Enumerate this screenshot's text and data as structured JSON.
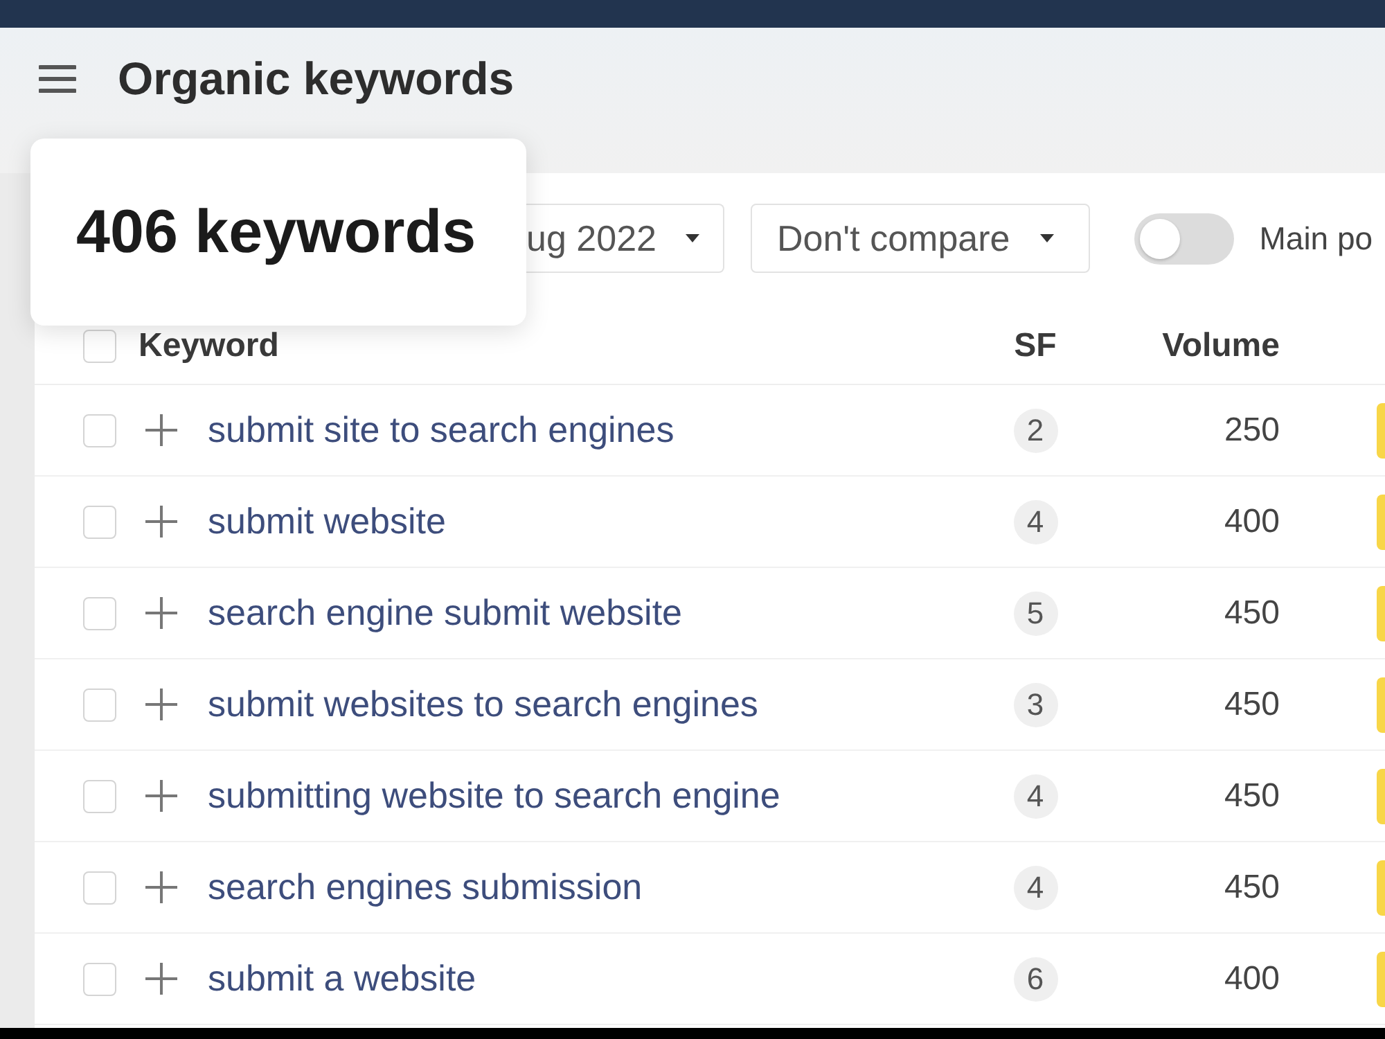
{
  "header": {
    "title": "Organic keywords"
  },
  "popover": {
    "text": "406 keywords"
  },
  "toolbar": {
    "date_select": {
      "value": "ug 2022"
    },
    "compare_select": {
      "value": "Don't compare"
    },
    "toggle": {
      "label": "Main po",
      "on": false
    }
  },
  "table": {
    "select_all": {
      "checked": false
    },
    "columns": [
      "Keyword",
      "SF",
      "Volume"
    ],
    "rows": [
      {
        "checked": false,
        "keyword": "submit site to search engines",
        "sf": "2",
        "volume": "250",
        "color": "#f8d648"
      },
      {
        "checked": false,
        "keyword": "submit website",
        "sf": "4",
        "volume": "400",
        "color": "#f8d648"
      },
      {
        "checked": false,
        "keyword": "search engine submit website",
        "sf": "5",
        "volume": "450",
        "color": "#f8d648"
      },
      {
        "checked": false,
        "keyword": "submit websites to search engines",
        "sf": "3",
        "volume": "450",
        "color": "#f8d648"
      },
      {
        "checked": false,
        "keyword": "submitting website to search engine",
        "sf": "4",
        "volume": "450",
        "color": "#f8d648"
      },
      {
        "checked": false,
        "keyword": "search engines submission",
        "sf": "4",
        "volume": "450",
        "color": "#f8d648"
      },
      {
        "checked": false,
        "keyword": "submit a website",
        "sf": "6",
        "volume": "400",
        "color": "#f8d648"
      }
    ]
  }
}
